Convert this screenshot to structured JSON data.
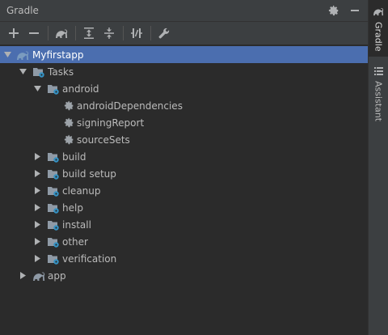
{
  "panel": {
    "title": "Gradle"
  },
  "toolbar": {
    "buttons": [
      "add-icon",
      "minus-icon",
      "gradle-elephant-icon",
      "expand-all-icon",
      "collapse-all-icon",
      "toggle-offline-icon",
      "settings-wrench-icon"
    ]
  },
  "tree": {
    "root": "Myfirstapp",
    "tasks": "Tasks",
    "android": "android",
    "android_tasks": [
      "androidDependencies",
      "signingReport",
      "sourceSets"
    ],
    "groups": [
      "build",
      "build setup",
      "cleanup",
      "help",
      "install",
      "other",
      "verification"
    ],
    "app": "app"
  },
  "sidebar": {
    "tabs": [
      "Gradle",
      "Assistant"
    ]
  },
  "colors": {
    "background": "#2b2b2b",
    "header": "#3c3f41",
    "selection": "#4b6eaf",
    "text": "#bbbbbb",
    "gear_blue": "#3592c4"
  }
}
